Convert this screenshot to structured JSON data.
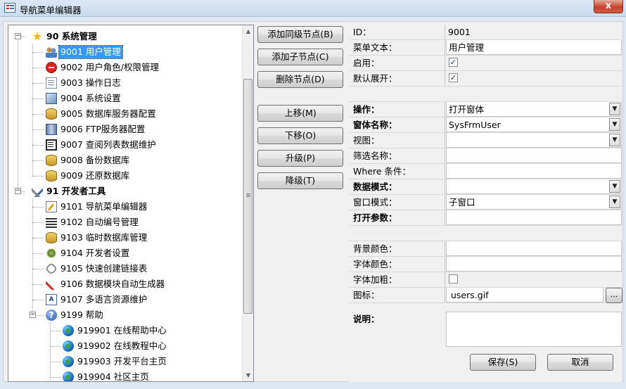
{
  "window": {
    "title": "导航菜单编辑器",
    "close_label": "x"
  },
  "tree": {
    "nodes": [
      {
        "label": "90 系统管理",
        "icon": "star-icon",
        "level": 0,
        "expander": "−",
        "bold": true
      },
      {
        "label": "9001 用户管理",
        "icon": "users-icon",
        "level": 1,
        "selected": true
      },
      {
        "label": "9002 用户角色/权限管理",
        "icon": "no-entry-icon",
        "level": 1
      },
      {
        "label": "9003 操作日志",
        "icon": "document-icon",
        "level": 1
      },
      {
        "label": "9004 系统设置",
        "icon": "settings-icon",
        "level": 1
      },
      {
        "label": "9005 数据库服务器配置",
        "icon": "database-icon",
        "level": 1
      },
      {
        "label": "9006 FTP服务器配置",
        "icon": "server-icon",
        "level": 1
      },
      {
        "label": "9007 查阅列表数据维护",
        "icon": "list-icon",
        "level": 1
      },
      {
        "label": "9008 备份数据库",
        "icon": "database-icon",
        "level": 1
      },
      {
        "label": "9009 还原数据库",
        "icon": "database-icon",
        "level": 1
      },
      {
        "label": "91 开发者工具",
        "icon": "tools-icon",
        "level": 0,
        "expander": "−",
        "bold": true
      },
      {
        "label": "9101 导航菜单编辑器",
        "icon": "edit-icon",
        "level": 1
      },
      {
        "label": "9102 自动编号管理",
        "icon": "numbered-list-icon",
        "level": 1
      },
      {
        "label": "9103 临时数据库管理",
        "icon": "database-icon",
        "level": 1
      },
      {
        "label": "9104 开发者设置",
        "icon": "gear-icon",
        "level": 1
      },
      {
        "label": "9105 快速创建链接表",
        "icon": "link-icon",
        "level": 1
      },
      {
        "label": "9106 数据模块自动生成器",
        "icon": "wand-icon",
        "level": 1
      },
      {
        "label": "9107 多语言资源维护",
        "icon": "language-icon",
        "level": 1
      },
      {
        "label": "9199 帮助",
        "icon": "help-icon",
        "level": 1,
        "expander": "−"
      },
      {
        "label": "919901 在线帮助中心",
        "icon": "globe-icon",
        "level": 2
      },
      {
        "label": "919902 在线教程中心",
        "icon": "globe-icon",
        "level": 2
      },
      {
        "label": "919903 开发平台主页",
        "icon": "globe-icon",
        "level": 2
      },
      {
        "label": "919904 社区主页",
        "icon": "globe-icon",
        "level": 2
      }
    ]
  },
  "actions": {
    "add_sibling": "添加同级节点(B)",
    "add_child": "添加子节点(C)",
    "delete_node": "删除节点(D)",
    "move_up": "上移(M)",
    "move_down": "下移(O)",
    "promote": "升级(P)",
    "demote": "降级(T)",
    "save": "保存(S)",
    "cancel": "取消",
    "browse": "..."
  },
  "properties": {
    "id": {
      "label": "ID：",
      "value": "9001"
    },
    "menu_text": {
      "label": "菜单文本：",
      "value": "用户管理"
    },
    "enabled": {
      "label": "启用：",
      "checked": true
    },
    "default_expand": {
      "label": "默认展开：",
      "checked": true
    },
    "operation": {
      "label": "操作：",
      "value": "打开窗体"
    },
    "form_name": {
      "label": "窗体名称：",
      "value": "SysFrmUser"
    },
    "view": {
      "label": "视图：",
      "value": ""
    },
    "filter_name": {
      "label": "筛选名称：",
      "value": ""
    },
    "where_condition": {
      "label": "Where 条件：",
      "value": ""
    },
    "data_mode": {
      "label": "数据模式：",
      "value": ""
    },
    "window_mode": {
      "label": "窗口模式：",
      "value": "子窗口"
    },
    "open_args": {
      "label": "打开参数：",
      "value": ""
    },
    "back_color": {
      "label": "背景颜色：",
      "value": ""
    },
    "font_color": {
      "label": "字体颜色：",
      "value": ""
    },
    "font_bold": {
      "label": "字体加粗：",
      "checked": false
    },
    "icon": {
      "label": "图标：",
      "value": "users.gif"
    },
    "description": {
      "label": "说明：",
      "value": ""
    }
  },
  "colors": {
    "selection": "#3399ff",
    "window_bg": "#f0f0f0",
    "close_red": "#c7432f"
  }
}
